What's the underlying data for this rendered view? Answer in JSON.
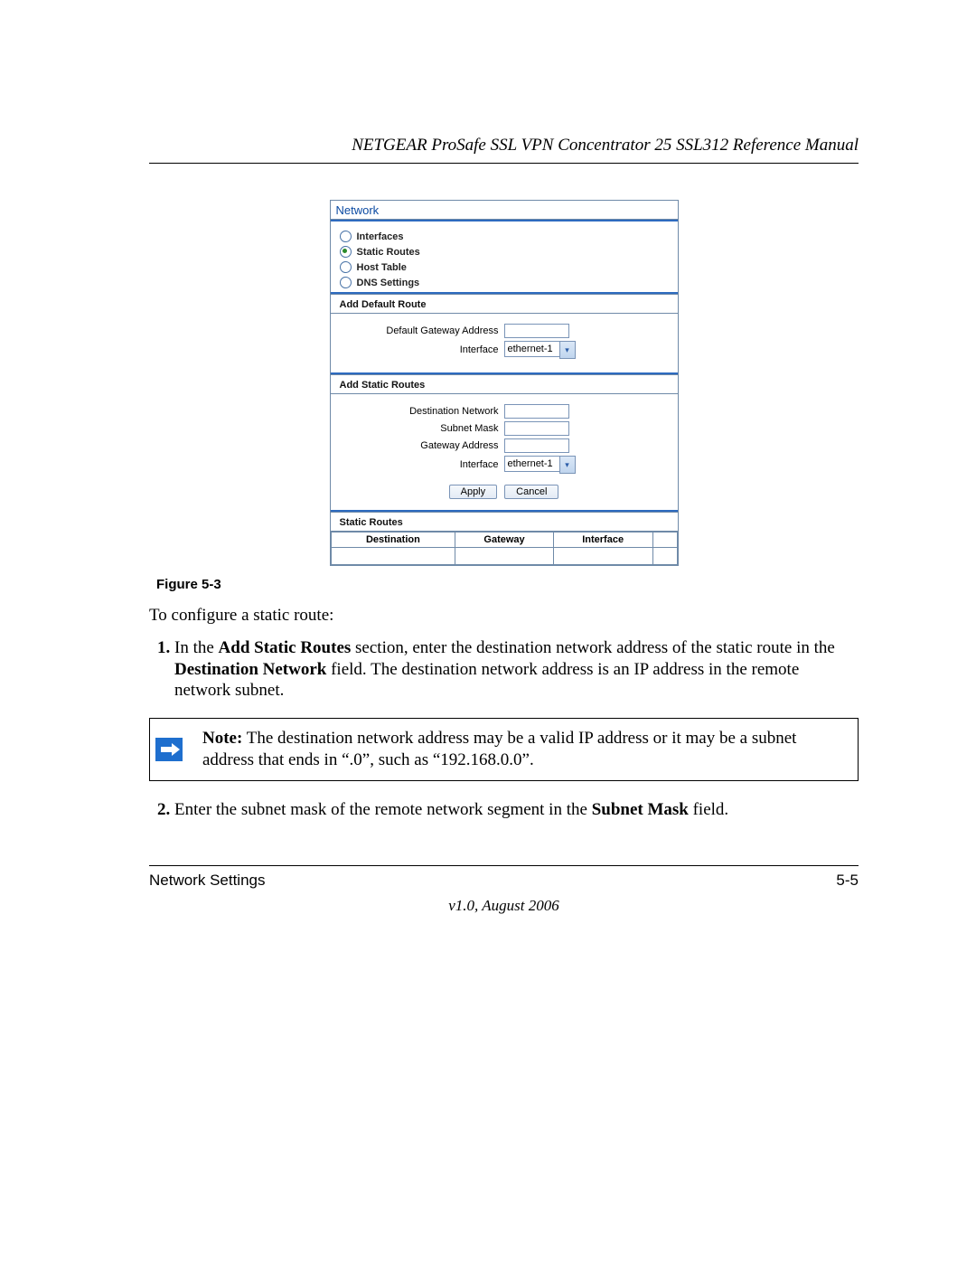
{
  "header": {
    "title": "NETGEAR ProSafe SSL VPN Concentrator 25 SSL312 Reference Manual"
  },
  "screenshot": {
    "panel_title": "Network",
    "radios": {
      "interfaces": "Interfaces",
      "static_routes": "Static Routes",
      "host_table": "Host Table",
      "dns_settings": "DNS Settings",
      "selected_index": 1
    },
    "default_route": {
      "heading": "Add Default Route",
      "gateway_label": "Default Gateway Address",
      "gateway_value": "",
      "iface_label": "Interface",
      "iface_value": "ethernet-1"
    },
    "static_add": {
      "heading": "Add Static Routes",
      "dest_label": "Destination Network",
      "dest_value": "",
      "mask_label": "Subnet Mask",
      "mask_value": "",
      "gw_label": "Gateway Address",
      "gw_value": "",
      "iface_label": "Interface",
      "iface_value": "ethernet-1",
      "apply": "Apply",
      "cancel": "Cancel"
    },
    "routes_table": {
      "heading": "Static Routes",
      "col_dest": "Destination",
      "col_gw": "Gateway",
      "col_if": "Interface"
    }
  },
  "caption": "Figure 5-3",
  "intro": "To configure a static route:",
  "step1_a": "In the ",
  "step1_b": "Add Static Routes",
  "step1_c": " section, enter the destination network address of the static route in the ",
  "step1_d": "Destination Network",
  "step1_e": " field. The destination network address is an IP address in the remote network subnet.",
  "note_label": "Note:",
  "note_body": " The destination network address may be a valid IP address or it may be a subnet address that ends in “.0”, such as “192.168.0.0”.",
  "step2_a": "Enter the subnet mask of the remote network segment in the ",
  "step2_b": "Subnet Mask",
  "step2_c": " field.",
  "footer": {
    "left": "Network Settings",
    "right": "5-5",
    "version": "v1.0, August 2006"
  }
}
